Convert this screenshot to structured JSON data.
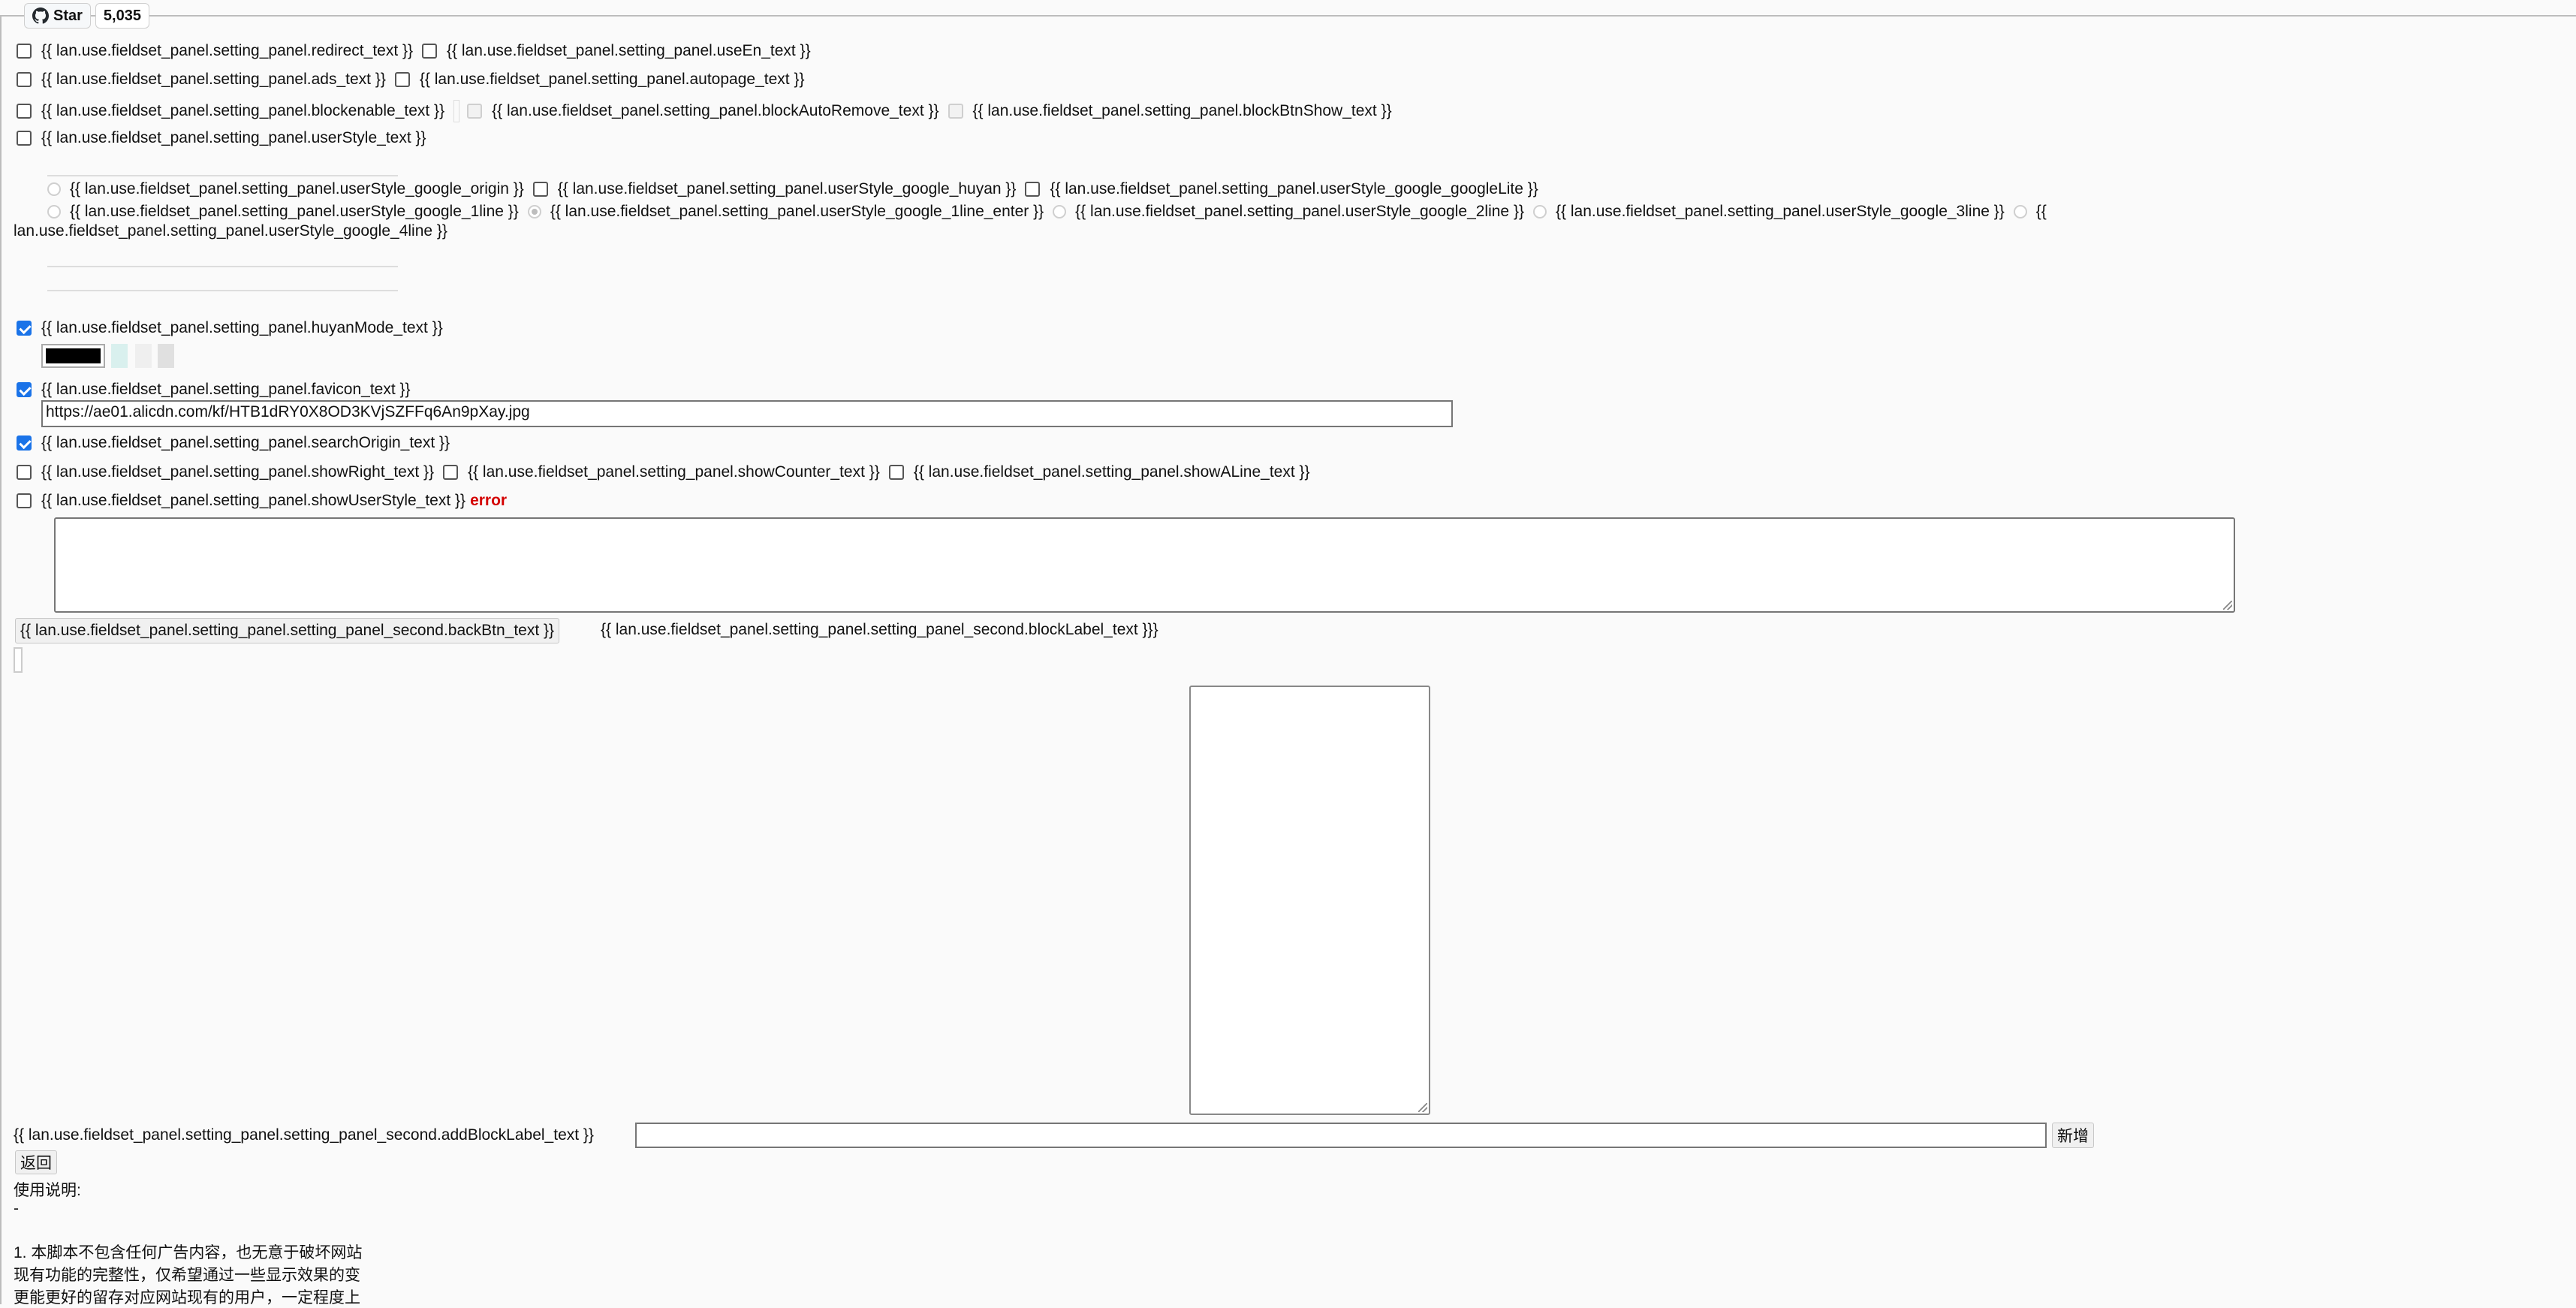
{
  "github": {
    "star_label": "Star",
    "star_count": "5,035"
  },
  "settings": {
    "redirect": "{{ lan.use.fieldset_panel.setting_panel.redirect_text }}",
    "useEn": "{{ lan.use.fieldset_panel.setting_panel.useEn_text }}",
    "ads": "{{ lan.use.fieldset_panel.setting_panel.ads_text }}",
    "autopage": "{{ lan.use.fieldset_panel.setting_panel.autopage_text }}",
    "blockenable": "{{ lan.use.fieldset_panel.setting_panel.blockenable_text }}",
    "blockAutoRemove": "{{ lan.use.fieldset_panel.setting_panel.blockAutoRemove_text }}",
    "blockBtnShow": "{{ lan.use.fieldset_panel.setting_panel.blockBtnShow_text }}",
    "userStyle": "{{ lan.use.fieldset_panel.setting_panel.userStyle_text }}",
    "google_origin": "{{ lan.use.fieldset_panel.setting_panel.userStyle_google_origin }}",
    "google_huyan": "{{ lan.use.fieldset_panel.setting_panel.userStyle_google_huyan }}",
    "google_googleLite": "{{ lan.use.fieldset_panel.setting_panel.userStyle_google_googleLite }}",
    "google_1line": "{{ lan.use.fieldset_panel.setting_panel.userStyle_google_1line }}",
    "google_1line_enter": "{{ lan.use.fieldset_panel.setting_panel.userStyle_google_1line_enter }}",
    "google_2line": "{{ lan.use.fieldset_panel.setting_panel.userStyle_google_2line }}",
    "google_3line": "{{ lan.use.fieldset_panel.setting_panel.userStyle_google_3line }}",
    "google_4line_a": "{{",
    "google_4line_b": "lan.use.fieldset_panel.setting_panel.userStyle_google_4line }}",
    "huyanMode": "{{ lan.use.fieldset_panel.setting_panel.huyanMode_text }}",
    "favicon": "{{ lan.use.fieldset_panel.setting_panel.favicon_text }}",
    "favicon_url": "https://ae01.alicdn.com/kf/HTB1dRY0X8OD3KVjSZFFq6An9pXay.jpg",
    "searchOrigin": "{{ lan.use.fieldset_panel.setting_panel.searchOrigin_text }}",
    "showRight": "{{ lan.use.fieldset_panel.setting_panel.showRight_text }}",
    "showCounter": "{{ lan.use.fieldset_panel.setting_panel.showCounter_text }}",
    "showALine": "{{ lan.use.fieldset_panel.setting_panel.showALine_text }}",
    "showUserStyle": "{{ lan.use.fieldset_panel.setting_panel.showUserStyle_text }}",
    "error": "error"
  },
  "second": {
    "backBtn": "{{ lan.use.fieldset_panel.setting_panel.setting_panel_second.backBtn_text }}",
    "blockLabel": "{{ lan.use.fieldset_panel.setting_panel.setting_panel_second.blockLabel_text }}}",
    "addBlockLabel": "{{ lan.use.fieldset_panel.setting_panel.setting_panel_second.addBlockLabel_text }}",
    "add_button": "新增",
    "back_button": "返回"
  },
  "usage": {
    "title": "使用说明:",
    "dash": "-",
    "line1": "1. 本脚本不包含任何广告内容，也无意于破坏网站",
    "line2": "现有功能的完整性，仅希望通过一些显示效果的变",
    "line3": "更能更好的留存对应网站现有的用户，一定程度上"
  },
  "colors": {
    "huyan_swatch": "#000000",
    "swatch2": "#d9f0ee",
    "swatch3": "#efefef",
    "swatch4": "#e0e0e0",
    "error": "#d40000",
    "checkbox_on": "#1a73e8"
  }
}
